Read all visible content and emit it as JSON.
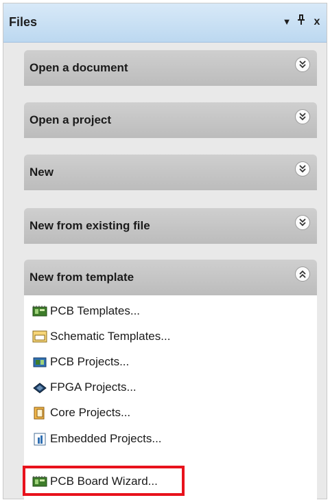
{
  "panel": {
    "title": "Files",
    "buttons": {
      "dropdown": "▼",
      "pin": "ᆍ",
      "close": "x"
    }
  },
  "sections": {
    "open_document": {
      "label": "Open a document",
      "state": "collapsed"
    },
    "open_project": {
      "label": "Open a project",
      "state": "collapsed"
    },
    "new": {
      "label": "New",
      "state": "collapsed"
    },
    "new_existing": {
      "label": "New from existing file",
      "state": "collapsed"
    },
    "new_template": {
      "label": "New from template",
      "state": "expanded"
    }
  },
  "template_items": [
    {
      "label": "PCB Templates...",
      "icon": "pcb-board-icon"
    },
    {
      "label": "Schematic Templates...",
      "icon": "schematic-icon"
    },
    {
      "label": "PCB Projects...",
      "icon": "pcb-project-icon"
    },
    {
      "label": "FPGA Projects...",
      "icon": "fpga-chip-icon"
    },
    {
      "label": "Core Projects...",
      "icon": "core-project-icon"
    },
    {
      "label": "Embedded Projects...",
      "icon": "embedded-project-icon"
    },
    {
      "label": "PCB Board Wizard...",
      "icon": "pcb-wizard-icon"
    }
  ],
  "colors": {
    "header": "#c6def5",
    "section_bar": "#c4c4c4",
    "highlight": "#e8121c"
  }
}
